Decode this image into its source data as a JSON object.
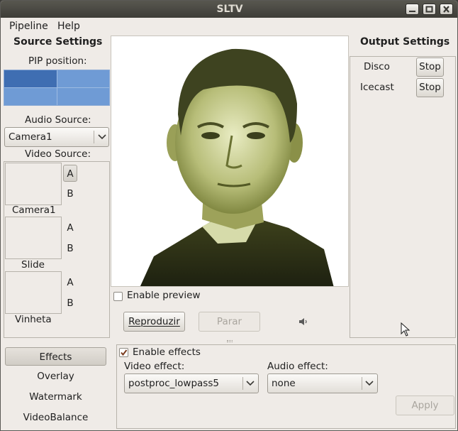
{
  "window": {
    "title": "SLTV"
  },
  "menu": {
    "items": [
      "Pipeline",
      "Help"
    ]
  },
  "source_settings": {
    "title": "Source Settings",
    "pip_label": "PIP position:",
    "audio_source_label": "Audio Source:",
    "audio_source_value": "Camera1",
    "video_source_label": "Video Source:",
    "sources": [
      {
        "name": "Camera1",
        "a": "A",
        "b": "B",
        "a_active": true
      },
      {
        "name": "Slide",
        "a": "A",
        "b": "B",
        "a_active": false
      },
      {
        "name": "Vinheta",
        "a": "A",
        "b": "B",
        "a_active": false
      }
    ]
  },
  "preview": {
    "enable_preview_label": "Enable preview",
    "enable_preview_checked": false,
    "play_label": "Reproduzir",
    "stop_label": "Parar",
    "volume_icon": "speaker-low-icon"
  },
  "output_settings": {
    "title": "Output Settings",
    "outputs": [
      {
        "name": "Disco",
        "button": "Stop"
      },
      {
        "name": "Icecast",
        "button": "Stop"
      }
    ]
  },
  "side_tabs": [
    "Effects",
    "Overlay",
    "Watermark",
    "VideoBalance"
  ],
  "effects": {
    "enable_label": "Enable effects",
    "enable_checked": true,
    "video_effect_label": "Video effect:",
    "video_effect_value": "postproc_lowpass5",
    "audio_effect_label": "Audio effect:",
    "audio_effect_value": "none",
    "apply_label": "Apply"
  }
}
